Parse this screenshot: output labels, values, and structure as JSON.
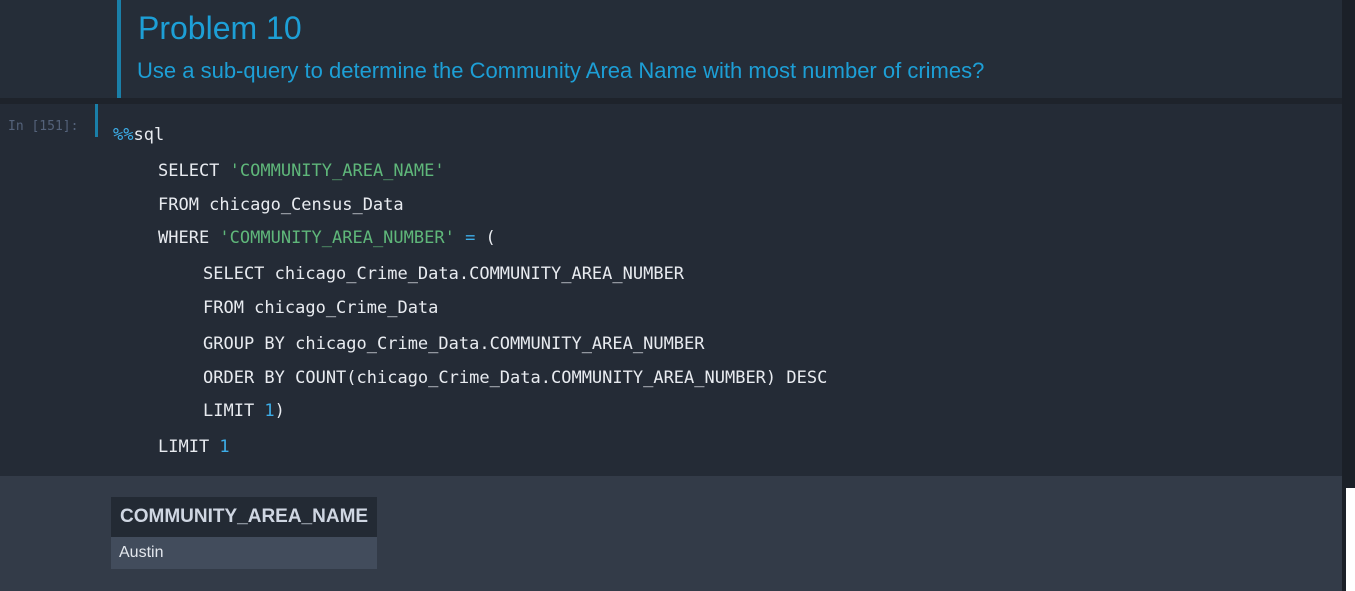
{
  "markdown_cell": {
    "title": "Problem 10",
    "subtitle": "Use a sub-query to determine the Community Area Name with most number of crimes?"
  },
  "code_cell": {
    "prompt": "In [151]:",
    "lines": [
      {
        "magic": "%%",
        "text": "sql"
      },
      {
        "kw": "SELECT ",
        "str": "'COMMUNITY_AREA_NAME'"
      },
      {
        "text": "FROM chicago_Census_Data"
      },
      {
        "kw": "WHERE ",
        "str": "'COMMUNITY_AREA_NUMBER'",
        "op": " = ",
        "rest": "("
      },
      {
        "text": "SELECT chicago_Crime_Data.COMMUNITY_AREA_NUMBER"
      },
      {
        "text": "FROM chicago_Crime_Data"
      },
      {
        "text": "GROUP BY chicago_Crime_Data.COMMUNITY_AREA_NUMBER"
      },
      {
        "text": "ORDER BY COUNT(chicago_Crime_Data.COMMUNITY_AREA_NUMBER) DESC"
      },
      {
        "kw": "LIMIT ",
        "num": "1",
        "rest": ")"
      },
      {
        "kw": "LIMIT ",
        "num": "1"
      }
    ]
  },
  "output": {
    "table": {
      "header": "COMMUNITY_AREA_NAME",
      "rows": [
        "Austin"
      ]
    }
  },
  "colors": {
    "accent": "#1d9fd6",
    "string": "#5fb77a",
    "number": "#3daee9"
  }
}
